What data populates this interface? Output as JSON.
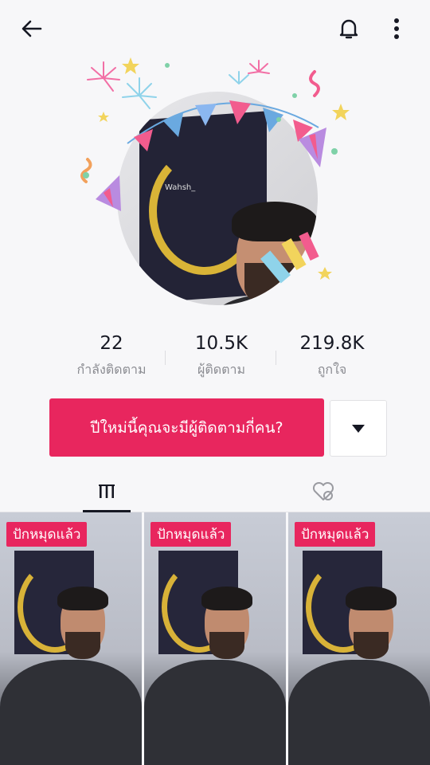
{
  "header": {
    "back_icon": "arrow-left-icon",
    "notification_icon": "bell-icon",
    "more_icon": "vertical-dots-icon"
  },
  "profile": {
    "avatar_poster_text": "Wahsh_"
  },
  "stats": [
    {
      "value": "22",
      "label": "กำลังติดตาม"
    },
    {
      "value": "10.5K",
      "label": "ผู้ติดตาม"
    },
    {
      "value": "219.8K",
      "label": "ถูกใจ"
    }
  ],
  "actions": {
    "cta_label": "ปีใหม่นี้คุณจะมีผู้ติดตามกี่คน?",
    "dropdown_icon": "caret-down-icon"
  },
  "tabs": [
    {
      "name": "videos",
      "icon": "grid-bars-icon",
      "active": true
    },
    {
      "name": "liked",
      "icon": "hidden-heart-icon",
      "active": false
    }
  ],
  "videos": [
    {
      "badge": "ปักหมุดแล้ว"
    },
    {
      "badge": "ปักหมุดแล้ว"
    },
    {
      "badge": "ปักหมุดแล้ว"
    }
  ],
  "colors": {
    "accent": "#e8265e",
    "text": "#161823",
    "muted": "#8a8b91"
  }
}
